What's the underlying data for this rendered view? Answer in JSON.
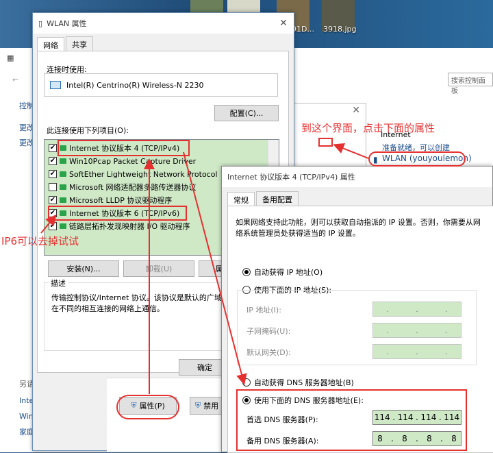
{
  "desktop": {
    "icons": [
      {
        "label": ""
      },
      {
        "label": ""
      },
      {
        "label": "91D..."
      },
      {
        "label": "3918.jpg"
      }
    ]
  },
  "control_panel": {
    "sidebar_links": [
      "控制",
      "更改",
      "更改"
    ],
    "see_also_title": "另请参阅",
    "see_also": [
      "Internet 选项",
      "Windows 防火墙",
      "家庭组"
    ],
    "search_placeholder": "搜索控制面板",
    "internet_label": "Internet",
    "connect_text": "准备就绪，可以创建",
    "wlan_link": "WLAN (youyoulemon)"
  },
  "wlan_dialog": {
    "title": "WLAN 属性",
    "tabs": [
      "网络",
      "共享"
    ],
    "connect_using_label": "连接时使用:",
    "adapter_name": "Intel(R) Centrino(R) Wireless-N 2230",
    "configure_button": "配置(C)...",
    "items_label": "此连接使用下列项目(O):",
    "items": [
      {
        "checked": true,
        "label": "Internet 协议版本 4 (TCP/IPv4)"
      },
      {
        "checked": true,
        "label": "Win10Pcap Packet Capture Driver"
      },
      {
        "checked": true,
        "label": "SoftEther Lightweight Network Protocol"
      },
      {
        "checked": false,
        "label": "Microsoft 网络适配器多路传送器协议"
      },
      {
        "checked": true,
        "label": "Microsoft LLDP 协议驱动程序"
      },
      {
        "checked": true,
        "label": "Internet 协议版本 6 (TCP/IPv6)"
      },
      {
        "checked": true,
        "label": "链路层拓扑发现映射器 I/O 驱动程序"
      }
    ],
    "install_button": "安装(N)...",
    "uninstall_button": "卸载(U)",
    "properties_button": "属",
    "desc_title": "描述",
    "desc_text": "传输控制协议/Internet 协议。该协议是默认的广域网络协议，用于在不同的相互连接的网络上通信。",
    "ok_button": "确定"
  },
  "bottom_buttons": {
    "properties": "属性(P)",
    "disable": "禁用"
  },
  "ipv4_dialog": {
    "title": "Internet 协议版本 4 (TCP/IPv4) 属性",
    "tabs": [
      "常规",
      "备用配置"
    ],
    "intro": "如果网络支持此功能，则可以获取自动指派的 IP 设置。否则，你需要从网络系统管理员处获得适当的 IP 设置。",
    "auto_ip": "自动获得 IP 地址(O)",
    "manual_ip": "使用下面的 IP 地址(S):",
    "ip_label": "IP 地址(I):",
    "mask_label": "子网掩码(U):",
    "gateway_label": "默认网关(D):",
    "auto_dns": "自动获得 DNS 服务器地址(B)",
    "manual_dns": "使用下面的 DNS 服务器地址(E):",
    "pref_dns_label": "首选 DNS 服务器(P):",
    "alt_dns_label": "备用 DNS 服务器(A):",
    "pref_dns": [
      "114",
      "114",
      "114",
      "114"
    ],
    "alt_dns": [
      "8",
      "8",
      "8",
      "8"
    ],
    "auto_ip_selected": true,
    "manual_dns_selected": true
  },
  "annotations": {
    "goto_text": "到这个界面，点击下面的属性",
    "ipv6_text": "IP6可以去掉试试",
    "color": "#e53030"
  }
}
